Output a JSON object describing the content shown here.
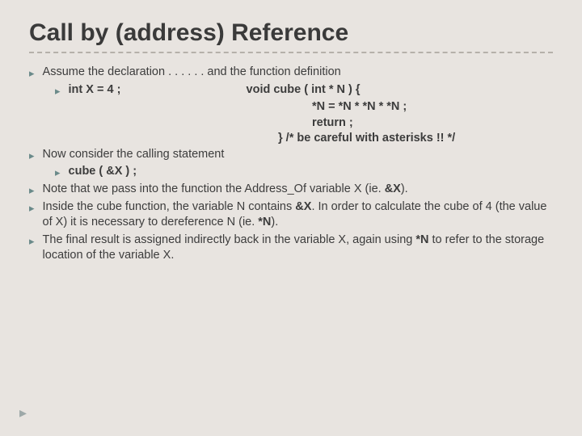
{
  "title": "Call by (address) Reference",
  "bullets": {
    "b1": {
      "text": "Assume the declaration . . . . . . and the function definition"
    },
    "b1a_left": "int   X = 4 ;",
    "b1a_right1": "void cube ( int * N ) {",
    "b1a_right2": "*N  =  *N  *  *N  *  *N ;",
    "b1a_right3": "return ;",
    "b1a_right4": "} /* be careful with asterisks !! */",
    "b2": {
      "text": "Now consider the calling statement"
    },
    "b2a": "cube ( &X ) ;",
    "b3_pre": "Note that we pass into the function the Address_Of variable X (ie. ",
    "b3_bold": "&X",
    "b3_post": ").",
    "b4_pre": "Inside the cube function, the variable N contains ",
    "b4_bold1": "&X",
    "b4_mid": ".  In order to calculate the cube of 4 (the value of X) it is necessary to dereference N (ie. ",
    "b4_bold2": "*N",
    "b4_post": ").",
    "b5_pre": "The final result is assigned indirectly back in the variable X, again using ",
    "b5_bold": "*N",
    "b5_post": " to refer to the storage location of the variable X."
  },
  "marker": "▸"
}
